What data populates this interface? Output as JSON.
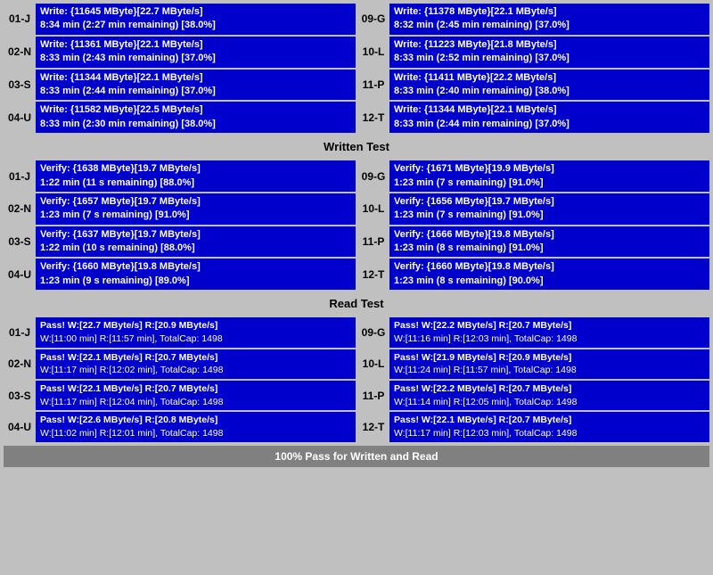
{
  "sections": {
    "write_test": {
      "label": "Written Test",
      "rows": [
        {
          "left": {
            "id": "01-J",
            "line1": "Write: {11645 MByte}[22.7 MByte/s]",
            "line2": "8:34 min (2:27 min remaining)  [38.0%]"
          },
          "right": {
            "id": "09-G",
            "line1": "Write: {11378 MByte}[22.1 MByte/s]",
            "line2": "8:32 min (2:45 min remaining)  [37.0%]"
          }
        },
        {
          "left": {
            "id": "02-N",
            "line1": "Write: {11361 MByte}[22.1 MByte/s]",
            "line2": "8:33 min (2:43 min remaining)  [37.0%]"
          },
          "right": {
            "id": "10-L",
            "line1": "Write: {11223 MByte}[21.8 MByte/s]",
            "line2": "8:33 min (2:52 min remaining)  [37.0%]"
          }
        },
        {
          "left": {
            "id": "03-S",
            "line1": "Write: {11344 MByte}[22.1 MByte/s]",
            "line2": "8:33 min (2:44 min remaining)  [37.0%]"
          },
          "right": {
            "id": "11-P",
            "line1": "Write: {11411 MByte}[22.2 MByte/s]",
            "line2": "8:33 min (2:40 min remaining)  [38.0%]"
          }
        },
        {
          "left": {
            "id": "04-U",
            "line1": "Write: {11582 MByte}[22.5 MByte/s]",
            "line2": "8:33 min (2:30 min remaining)  [38.0%]"
          },
          "right": {
            "id": "12-T",
            "line1": "Write: {11344 MByte}[22.1 MByte/s]",
            "line2": "8:33 min (2:44 min remaining)  [37.0%]"
          }
        }
      ]
    },
    "verify_test": {
      "rows": [
        {
          "left": {
            "id": "01-J",
            "line1": "Verify: {1638 MByte}[19.7 MByte/s]",
            "line2": "1:22 min (11 s remaining)   [88.0%]"
          },
          "right": {
            "id": "09-G",
            "line1": "Verify: {1671 MByte}[19.9 MByte/s]",
            "line2": "1:23 min (7 s remaining)   [91.0%]"
          }
        },
        {
          "left": {
            "id": "02-N",
            "line1": "Verify: {1657 MByte}[19.7 MByte/s]",
            "line2": "1:23 min (7 s remaining)   [91.0%]"
          },
          "right": {
            "id": "10-L",
            "line1": "Verify: {1656 MByte}[19.7 MByte/s]",
            "line2": "1:23 min (7 s remaining)   [91.0%]"
          }
        },
        {
          "left": {
            "id": "03-S",
            "line1": "Verify: {1637 MByte}[19.7 MByte/s]",
            "line2": "1:22 min (10 s remaining)   [88.0%]"
          },
          "right": {
            "id": "11-P",
            "line1": "Verify: {1666 MByte}[19.8 MByte/s]",
            "line2": "1:23 min (8 s remaining)   [91.0%]"
          }
        },
        {
          "left": {
            "id": "04-U",
            "line1": "Verify: {1660 MByte}[19.8 MByte/s]",
            "line2": "1:23 min (9 s remaining)   [89.0%]"
          },
          "right": {
            "id": "12-T",
            "line1": "Verify: {1660 MByte}[19.8 MByte/s]",
            "line2": "1:23 min (8 s remaining)   [90.0%]"
          }
        }
      ]
    },
    "read_test": {
      "label": "Read Test",
      "rows": [
        {
          "left": {
            "id": "01-J",
            "line1": "Pass! W:[22.7 MByte/s] R:[20.9 MByte/s]",
            "line2": "W:[11:00 min] R:[11:57 min], TotalCap: 1498"
          },
          "right": {
            "id": "09-G",
            "line1": "Pass! W:[22.2 MByte/s] R:[20.7 MByte/s]",
            "line2": "W:[11:16 min] R:[12:03 min], TotalCap: 1498"
          }
        },
        {
          "left": {
            "id": "02-N",
            "line1": "Pass! W:[22.1 MByte/s] R:[20.7 MByte/s]",
            "line2": "W:[11:17 min] R:[12:02 min], TotalCap: 1498"
          },
          "right": {
            "id": "10-L",
            "line1": "Pass! W:[21.9 MByte/s] R:[20.9 MByte/s]",
            "line2": "W:[11:24 min] R:[11:57 min], TotalCap: 1498"
          }
        },
        {
          "left": {
            "id": "03-S",
            "line1": "Pass! W:[22.1 MByte/s] R:[20.7 MByte/s]",
            "line2": "W:[11:17 min] R:[12:04 min], TotalCap: 1498"
          },
          "right": {
            "id": "11-P",
            "line1": "Pass! W:[22.2 MByte/s] R:[20.7 MByte/s]",
            "line2": "W:[11:14 min] R:[12:05 min], TotalCap: 1498"
          }
        },
        {
          "left": {
            "id": "04-U",
            "line1": "Pass! W:[22.6 MByte/s] R:[20.8 MByte/s]",
            "line2": "W:[11:02 min] R:[12:01 min], TotalCap: 1498"
          },
          "right": {
            "id": "12-T",
            "line1": "Pass! W:[22.1 MByte/s] R:[20.7 MByte/s]",
            "line2": "W:[11:17 min] R:[12:03 min], TotalCap: 1498"
          }
        }
      ]
    }
  },
  "headers": {
    "written_test": "Written Test",
    "read_test": "Read Test"
  },
  "footer": {
    "label": "100% Pass for Written and Read"
  }
}
